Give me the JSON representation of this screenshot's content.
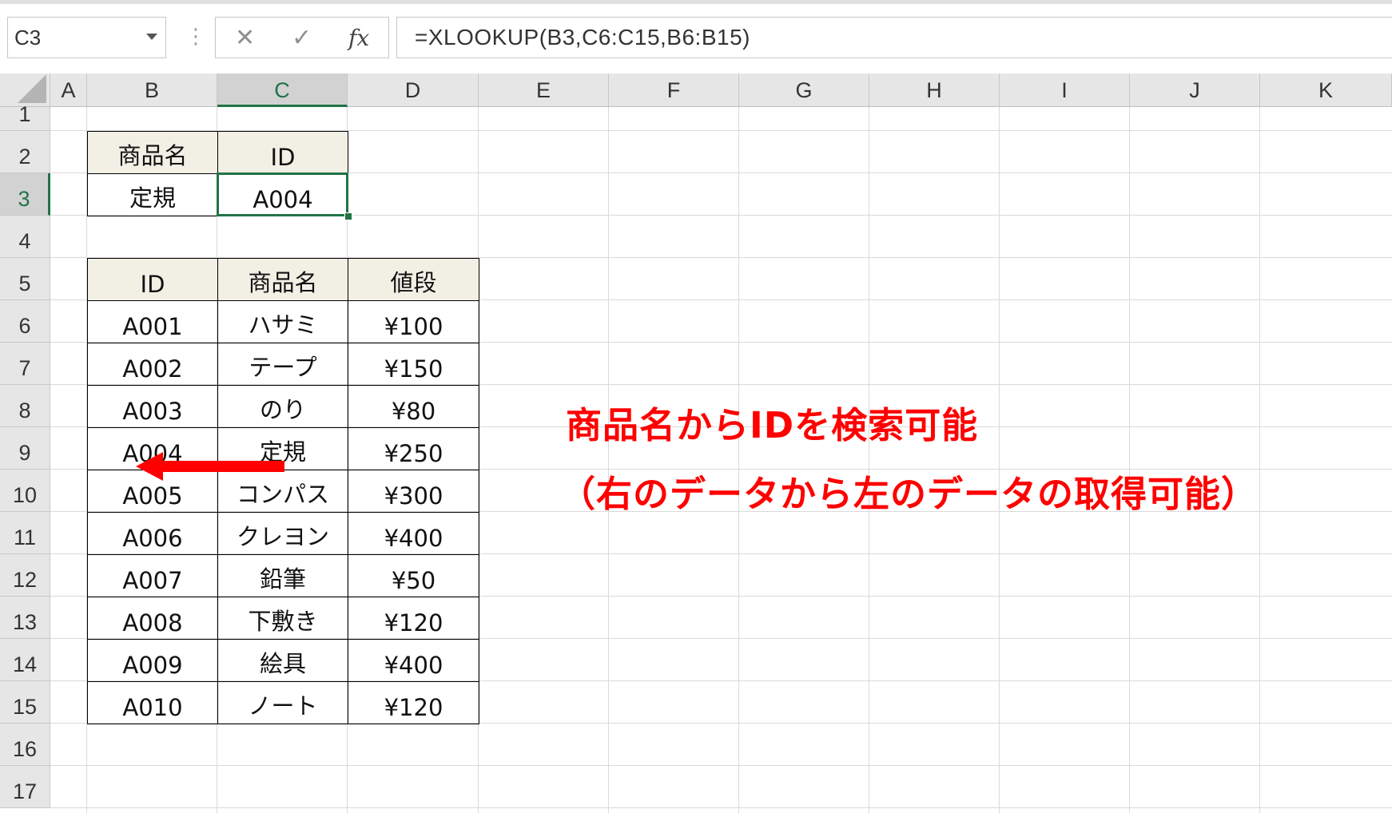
{
  "formula_bar": {
    "name_box": "C3",
    "formula": "=XLOOKUP(B3,C6:C15,B6:B15)",
    "cancel_icon": "✕",
    "enter_icon": "✓",
    "fx_icon": "fx",
    "grip": "⋮"
  },
  "columns": [
    "A",
    "B",
    "C",
    "D",
    "E",
    "F",
    "G",
    "H",
    "I",
    "J",
    "K"
  ],
  "rows": [
    "1",
    "2",
    "3",
    "4",
    "5",
    "6",
    "7",
    "8",
    "9",
    "10",
    "11",
    "12",
    "13",
    "14",
    "15",
    "16",
    "17"
  ],
  "selected_column": "C",
  "selected_row": "3",
  "lookup_table": {
    "headers": [
      "商品名",
      "ID"
    ],
    "values": [
      "定規",
      "A004"
    ]
  },
  "data_table": {
    "headers": [
      "ID",
      "商品名",
      "値段"
    ],
    "rows": [
      [
        "A001",
        "ハサミ",
        "¥100"
      ],
      [
        "A002",
        "テープ",
        "¥150"
      ],
      [
        "A003",
        "のり",
        "¥80"
      ],
      [
        "A004",
        "定規",
        "¥250"
      ],
      [
        "A005",
        "コンパス",
        "¥300"
      ],
      [
        "A006",
        "クレヨン",
        "¥400"
      ],
      [
        "A007",
        "鉛筆",
        "¥50"
      ],
      [
        "A008",
        "下敷き",
        "¥120"
      ],
      [
        "A009",
        "絵具",
        "¥400"
      ],
      [
        "A010",
        "ノート",
        "¥120"
      ]
    ]
  },
  "annotation": {
    "line1": "商品名からIDを検索可能",
    "line2": "（右のデータから左のデータの取得可能）",
    "color": "#ff0000"
  },
  "accent_color": "#217346"
}
